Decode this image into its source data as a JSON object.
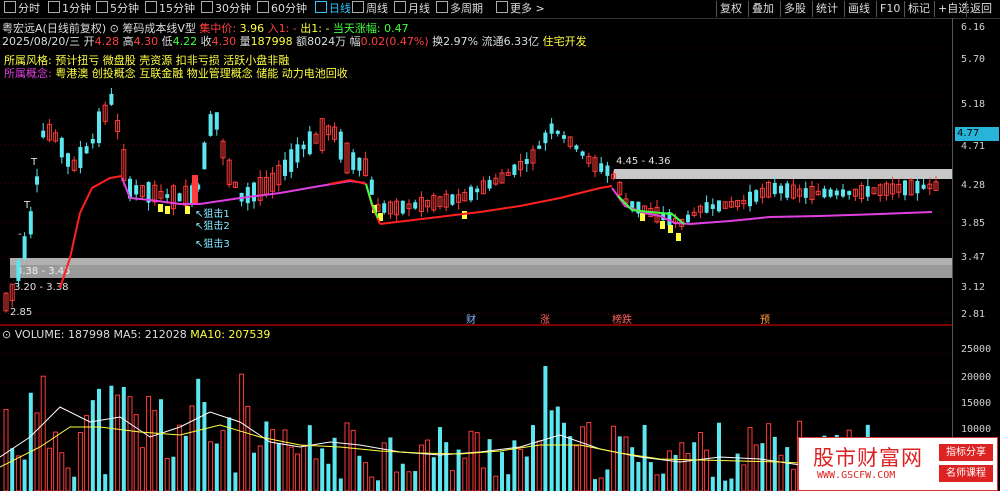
{
  "toolbar": {
    "timeframes": [
      "分时",
      "1分钟",
      "5分钟",
      "15分钟",
      "30分钟",
      "60分钟",
      "日线",
      "周线",
      "月线",
      "多周期",
      "更多 >"
    ],
    "active": "日线",
    "right_buttons": [
      "复权",
      "叠加",
      "多股",
      "统计",
      "画线",
      "F10",
      "标记",
      "+自选",
      "返回"
    ]
  },
  "info": {
    "stock": "粤宏远A(日线前复权)",
    "indicator": "筹码成本线V型",
    "jzj_label": "集中价:",
    "jzj_value": "3.96",
    "in_label": "入1: -",
    "out_label": "出1: -",
    "today_label": "当天涨幅:",
    "today_value": "0.47",
    "date": "2025/08/20/三",
    "open_label": "开",
    "open": "4.28",
    "high_label": "高",
    "high": "4.30",
    "low_label": "低",
    "low": "4.22",
    "close_label": "收",
    "close": "4.30",
    "vol_label": "量",
    "vol": "187998",
    "amount_label": "额",
    "amount": "8024万",
    "chg_label": "幅",
    "chg": "0.02(0.47%)",
    "turnover_label": "换",
    "turnover": "2.97%",
    "float_label": "流通",
    "float": "6.33亿",
    "sector": "住宅开发",
    "style_label": "所属风格:",
    "style_value": "预计扭亏 微盘股 壳资源 扣非亏损 活跃小盘非融",
    "concept_label": "所属概念:",
    "concept_value": "粤港澳 创投概念 互联金融 物业管理概念 储能 动力电池回收"
  },
  "chart_labels": {
    "zone_top": "4.45 - 4.36",
    "zone_mid": "3.38 - 3.45",
    "zone_low": "3.20 - 3.38",
    "low_mark": "2.85",
    "ambush": [
      "狙击1",
      "狙击2",
      "狙击3"
    ],
    "markers": [
      "财",
      "涨",
      "榜跌",
      "预"
    ],
    "t_marks": [
      "T",
      "T",
      "-"
    ]
  },
  "price_axis": {
    "ticks": [
      "6.16",
      "5.70",
      "5.18",
      "4.71",
      "4.28",
      "3.85",
      "3.47",
      "3.12",
      "2.81"
    ],
    "current": "4.77"
  },
  "volume": {
    "label": "VOLUME: 187998",
    "ma5": "MA5: 212028",
    "ma10": "MA10: 207539",
    "ticks": [
      "25000",
      "20000",
      "15000",
      "10000",
      "5000"
    ]
  },
  "watermark": {
    "title": "股市财富网",
    "url": "WWW.GSCFW.COM",
    "tag1": "指标分享",
    "tag2": "名师课程"
  },
  "colors": {
    "up": "#ff3b3b",
    "down": "#5ce6f0",
    "accent": "#2ec5ff",
    "yellow": "#ffff40",
    "magenta": "#e040e0",
    "cost_red": "#ff2020"
  }
}
